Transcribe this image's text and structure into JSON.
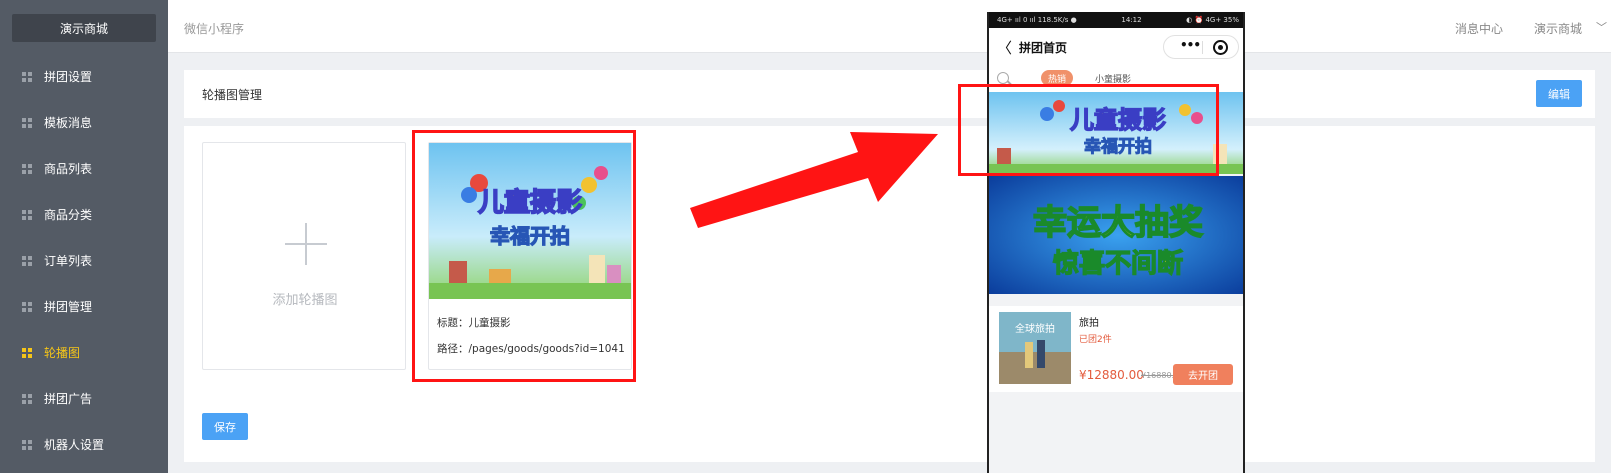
{
  "sidebar": {
    "brand": "演示商城",
    "items": [
      {
        "label": "拼团设置",
        "active": false
      },
      {
        "label": "模板消息",
        "active": false
      },
      {
        "label": "商品列表",
        "active": false
      },
      {
        "label": "商品分类",
        "active": false
      },
      {
        "label": "订单列表",
        "active": false
      },
      {
        "label": "拼团管理",
        "active": false
      },
      {
        "label": "轮播图",
        "active": true
      },
      {
        "label": "拼团广告",
        "active": false
      },
      {
        "label": "机器人设置",
        "active": false
      }
    ]
  },
  "header": {
    "breadcrumb": "微信小程序",
    "messages": "消息中心",
    "user": "演示商城",
    "caret": "﹀"
  },
  "main": {
    "panel_title": "轮播图管理",
    "edit_label": "编辑",
    "add_label": "添加轮播图",
    "banner": {
      "image_text_1": "儿童摄影",
      "image_text_2": "幸福开拍",
      "title_line": "标题：儿童摄影",
      "path_line": "路径：/pages/goods/goods?id=1041"
    },
    "save_label": "保存"
  },
  "phone": {
    "status_left": "4G+ ııl 0 ııl 118.5K/s ●",
    "status_time": "14:12",
    "status_right": "◐ ⏰ 4G+ 35%",
    "nav_title": "拼团首页",
    "back": "〈",
    "capsule_dots": "•••",
    "chips": [
      "热销",
      "小童摄影"
    ],
    "banner1_text_1": "儿童摄影",
    "banner1_text_2": "幸福开拍",
    "banner2_text_1": "幸运大抽奖",
    "banner2_text_2": "惊喜不间断",
    "product": {
      "thumb_label": "全球旅拍",
      "name": "旅拍",
      "sold": "已团2件",
      "price": "¥12880.00",
      "original_price": "¥16880.0",
      "button": "去开团"
    }
  },
  "colors": {
    "sidebar_bg": "#545b65",
    "active": "#f5c518",
    "primary": "#4ba2f5",
    "highlight": "#ff1414",
    "price": "#e35b3d"
  }
}
